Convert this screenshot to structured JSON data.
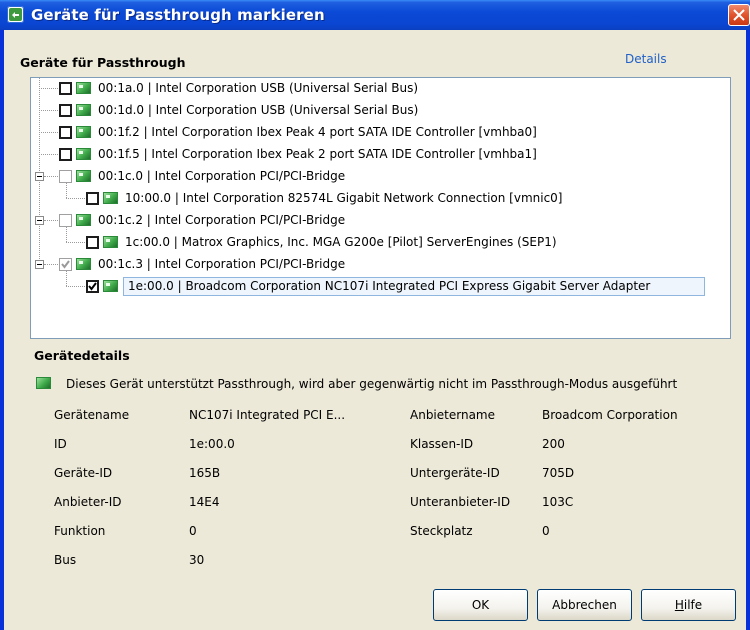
{
  "window": {
    "title": "Geräte für Passthrough markieren"
  },
  "group": {
    "title": "Geräte für Passthrough",
    "details_link": "Details"
  },
  "tree": [
    {
      "label": "00:1a.0 | Intel Corporation USB (Universal Serial Bus)",
      "checked": false
    },
    {
      "label": "00:1d.0 | Intel Corporation USB (Universal Serial Bus)",
      "checked": false
    },
    {
      "label": "00:1f.2 | Intel Corporation Ibex Peak 4 port SATA IDE Controller [vmhba0]",
      "checked": false
    },
    {
      "label": "00:1f.5 | Intel Corporation Ibex Peak 2 port SATA IDE Controller [vmhba1]",
      "checked": false
    },
    {
      "label": "00:1c.0 | Intel Corporation PCI/PCI-Bridge",
      "checked": false,
      "expanded": true
    },
    {
      "label": "10:00.0 | Intel Corporation 82574L Gigabit Network Connection [vmnic0]",
      "checked": false
    },
    {
      "label": "00:1c.2 | Intel Corporation PCI/PCI-Bridge",
      "checked": false,
      "expanded": true
    },
    {
      "label": "1c:00.0 | Matrox Graphics, Inc. MGA G200e [Pilot] ServerEngines (SEP1)",
      "checked": false
    },
    {
      "label": "00:1c.3 | Intel Corporation PCI/PCI-Bridge",
      "checked": true,
      "expanded": true
    },
    {
      "label": "1e:00.0 | Broadcom Corporation NC107i Integrated PCI Express Gigabit Server Adapter",
      "checked": true,
      "selected": true
    }
  ],
  "details": {
    "title": "Gerätedetails",
    "status_text": "Dieses Gerät unterstützt Passthrough, wird aber gegenwärtig nicht im Passthrough-Modus ausgeführt",
    "left": [
      {
        "label": "Gerätename",
        "value": "NC107i Integrated PCI E..."
      },
      {
        "label": "ID",
        "value": "1e:00.0"
      },
      {
        "label": "Geräte-ID",
        "value": "165B"
      },
      {
        "label": "Anbieter-ID",
        "value": "14E4"
      },
      {
        "label": "Funktion",
        "value": "0"
      },
      {
        "label": "Bus",
        "value": "30"
      }
    ],
    "right": [
      {
        "label": "Anbietername",
        "value": "Broadcom Corporation"
      },
      {
        "label": "Klassen-ID",
        "value": "200"
      },
      {
        "label": "Untergeräte-ID",
        "value": "705D"
      },
      {
        "label": "Unteranbieter-ID",
        "value": "103C"
      },
      {
        "label": "Steckplatz",
        "value": "0"
      }
    ]
  },
  "buttons": {
    "ok": "OK",
    "cancel": "Abbrechen",
    "help_prefix": "H",
    "help_rest": "ilfe"
  },
  "colors": {
    "titlebar": "#0a46d2",
    "dialog_bg": "#ece9d8",
    "link": "#2060c8",
    "selection_border": "#8fb6de"
  }
}
